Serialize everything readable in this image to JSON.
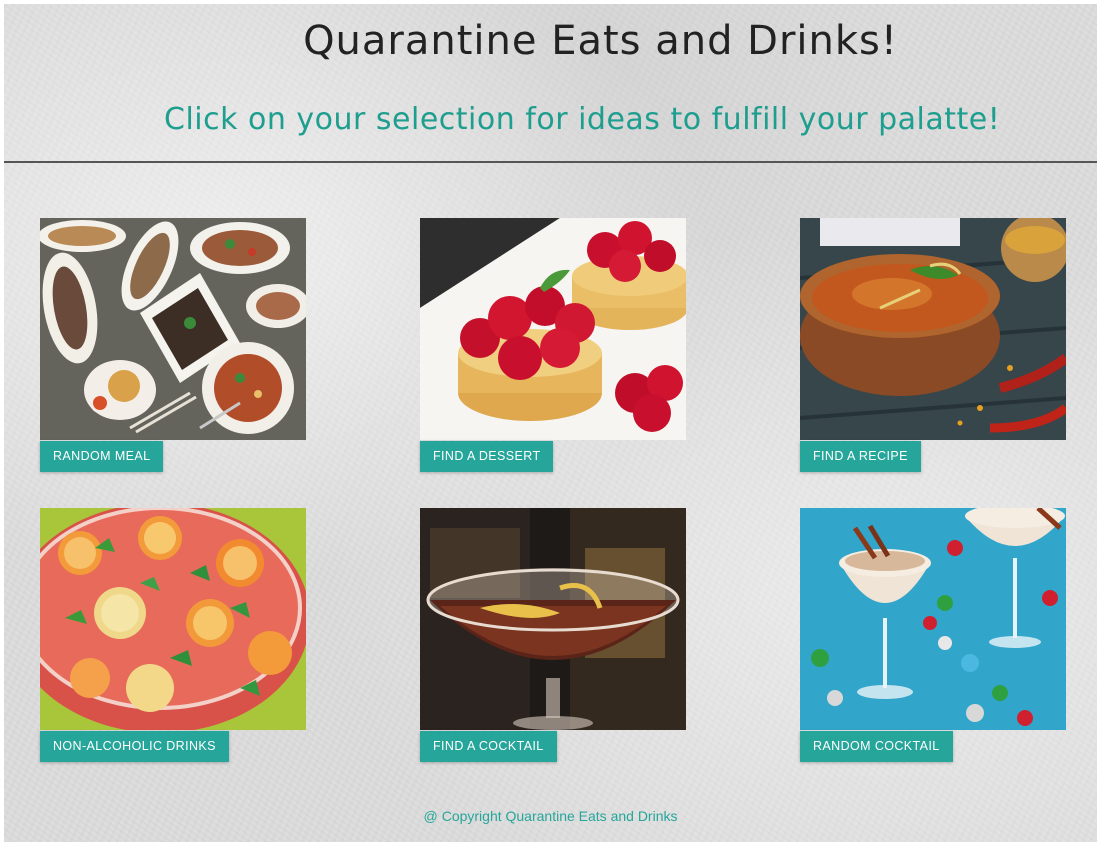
{
  "header": {
    "title": "Quarantine Eats and Drinks!",
    "subtitle": "Click on your selection for ideas to fulfill your palatte!"
  },
  "cards": [
    {
      "label": "RANDOM MEAL",
      "image": "assorted-asian-dishes-photo"
    },
    {
      "label": "FIND A DESSERT",
      "image": "raspberry-tarts-photo"
    },
    {
      "label": "FIND A RECIPE",
      "image": "curry-bowl-photo"
    },
    {
      "label": "NON-ALCOHOLIC DRINKS",
      "image": "fruit-punch-bowl-photo"
    },
    {
      "label": "FIND A COCKTAIL",
      "image": "cocktail-glass-photo"
    },
    {
      "label": "RANDOM COCKTAIL",
      "image": "eggnog-cocktails-photo"
    }
  ],
  "footer": {
    "copyright_symbol": "@",
    "text": "Copyright Quarantine Eats and Drinks"
  },
  "colors": {
    "accent": "#26a69a",
    "subtitle": "#1e9e8e",
    "title": "#222222"
  }
}
